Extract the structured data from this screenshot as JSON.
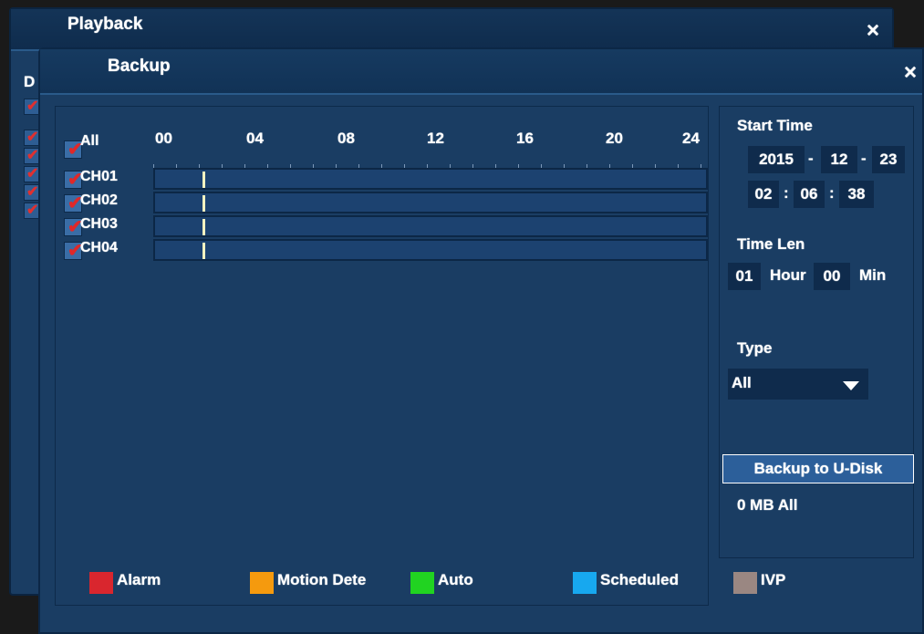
{
  "playback": {
    "title": "Playback",
    "close_icon": "×",
    "left_label": "D"
  },
  "backup": {
    "title": "Backup",
    "close_icon": "×",
    "all_label": "All",
    "hours": [
      "00",
      "04",
      "08",
      "12",
      "16",
      "20",
      "24"
    ],
    "channels": [
      {
        "label": "CH01",
        "checked": true
      },
      {
        "label": "CH02",
        "checked": true
      },
      {
        "label": "CH03",
        "checked": true
      },
      {
        "label": "CH04",
        "checked": true
      }
    ],
    "start_time": {
      "label": "Start Time",
      "year": "2015",
      "month": "12",
      "day": "23",
      "hour": "02",
      "minute": "06",
      "second": "38",
      "date_sep": "-",
      "time_sep": ":"
    },
    "time_len": {
      "label": "Time Len",
      "hours": "01",
      "hour_unit": "Hour",
      "minutes": "00",
      "min_unit": "Min"
    },
    "type": {
      "label": "Type",
      "selected": "All"
    },
    "backup_button": "Backup to U-Disk",
    "size_info": "0 MB All",
    "legend": [
      {
        "label": "Alarm",
        "color": "#d9262e"
      },
      {
        "label": "Motion Dete",
        "color": "#f59a0e"
      },
      {
        "label": "Auto",
        "color": "#21d321"
      },
      {
        "label": "Scheduled",
        "color": "#17a8ef"
      },
      {
        "label": "IVP",
        "color": "#9a8782"
      }
    ]
  }
}
